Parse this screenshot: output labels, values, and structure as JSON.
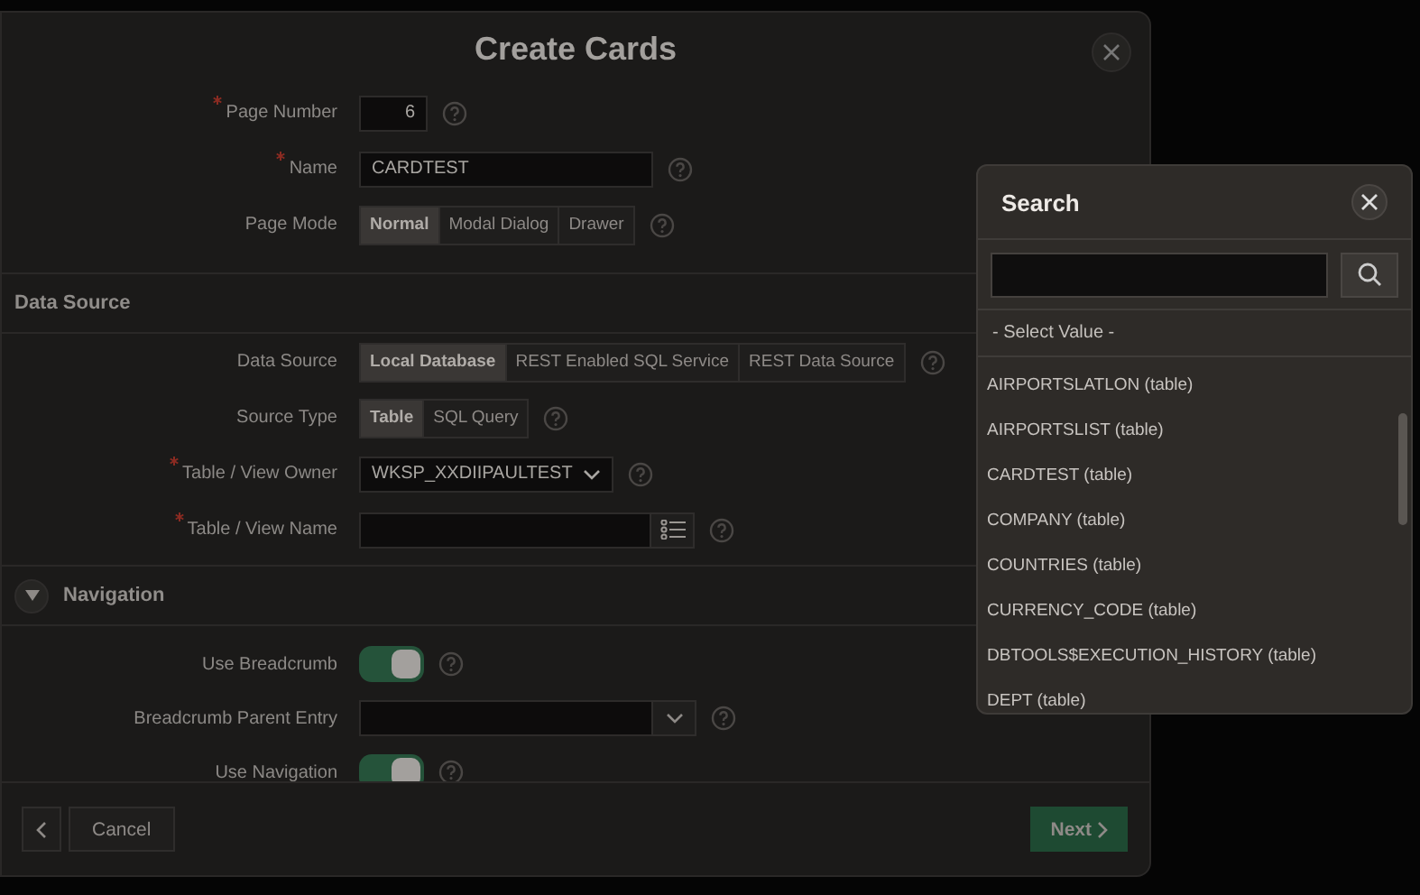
{
  "dialog": {
    "title": "Create Cards"
  },
  "page_fields": [
    {
      "kind": "number",
      "label": "Page Number",
      "required": true,
      "value": "6"
    },
    {
      "kind": "text",
      "label": "Name",
      "required": true,
      "value": "CARDTEST"
    },
    {
      "kind": "segmented",
      "label": "Page Mode",
      "required": false,
      "options": [
        {
          "label": "Normal",
          "selected": true
        },
        {
          "label": "Modal Dialog",
          "selected": false
        },
        {
          "label": "Drawer",
          "selected": false
        }
      ]
    }
  ],
  "data_source": {
    "heading": "Data Source",
    "fields": [
      {
        "kind": "segmented",
        "label": "Data Source",
        "required": false,
        "options": [
          {
            "label": "Local Database",
            "selected": true
          },
          {
            "label": "REST Enabled SQL Service",
            "selected": false
          },
          {
            "label": "REST Data Source",
            "selected": false
          }
        ]
      },
      {
        "kind": "segmented",
        "label": "Source Type",
        "required": false,
        "options": [
          {
            "label": "Table",
            "selected": true
          },
          {
            "label": "SQL Query",
            "selected": false
          }
        ]
      },
      {
        "kind": "select",
        "label": "Table / View Owner",
        "required": true,
        "value": "WKSP_XXDIIPAULTEST"
      },
      {
        "kind": "popup",
        "label": "Table / View Name",
        "required": true
      }
    ]
  },
  "navigation": {
    "heading": "Navigation",
    "expanded": true,
    "fields": [
      {
        "kind": "switch",
        "label": "Use Breadcrumb",
        "required": false,
        "on": true
      },
      {
        "kind": "combo",
        "label": "Breadcrumb Parent Entry",
        "required": false
      },
      {
        "kind": "switch",
        "label": "Use Navigation",
        "required": false,
        "on": true
      }
    ]
  },
  "footer": {
    "cancel": "Cancel",
    "next": "Next"
  },
  "search_popup": {
    "title": "Search",
    "null_option": "- Select Value -",
    "items": [
      "AIRPORTSLATLON (table)",
      "AIRPORTSLIST (table)",
      "CARDTEST (table)",
      "COMPANY (table)",
      "COUNTRIES (table)",
      "CURRENCY_CODE (table)",
      "DBTOOLS$EXECUTION_HISTORY (table)",
      "DEPT (table)"
    ]
  }
}
